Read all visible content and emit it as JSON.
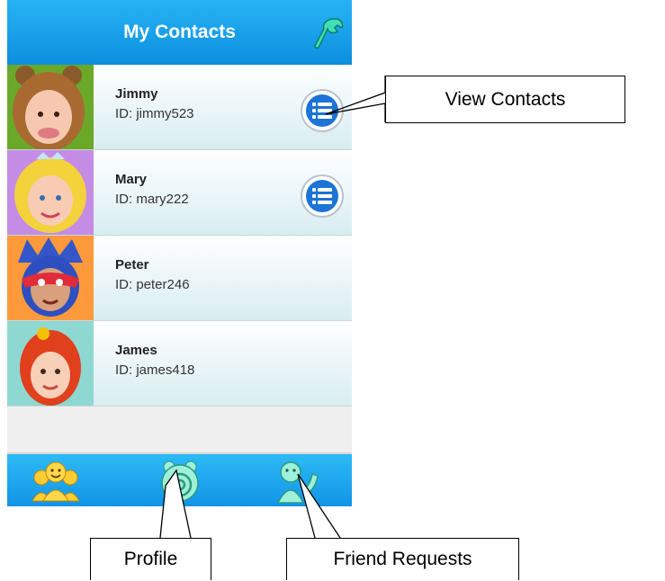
{
  "header": {
    "title": "My Contacts",
    "settings_icon": "wrench-icon"
  },
  "contacts": [
    {
      "name": "Jimmy",
      "id": "ID: jimmy523",
      "avatar": "bear-costume-avatar",
      "has_list_button": true
    },
    {
      "name": "Mary",
      "id": "ID: mary222",
      "avatar": "princess-avatar",
      "has_list_button": true
    },
    {
      "name": "Peter",
      "id": "ID: peter246",
      "avatar": "superhero-mask-avatar",
      "has_list_button": false
    },
    {
      "name": "James",
      "id": "ID: james418",
      "avatar": "red-hair-avatar",
      "has_list_button": false
    }
  ],
  "tabbar": {
    "items": [
      "contacts-group-icon",
      "profile-icon",
      "friend-requests-icon"
    ]
  },
  "callouts": {
    "view_contacts": "View Contacts",
    "profile": "Profile",
    "friend_requests": "Friend Requests"
  },
  "colors": {
    "header": "#1aa3ec",
    "list_button": "#1c74d6",
    "tab_icons": "#ffcc33"
  }
}
